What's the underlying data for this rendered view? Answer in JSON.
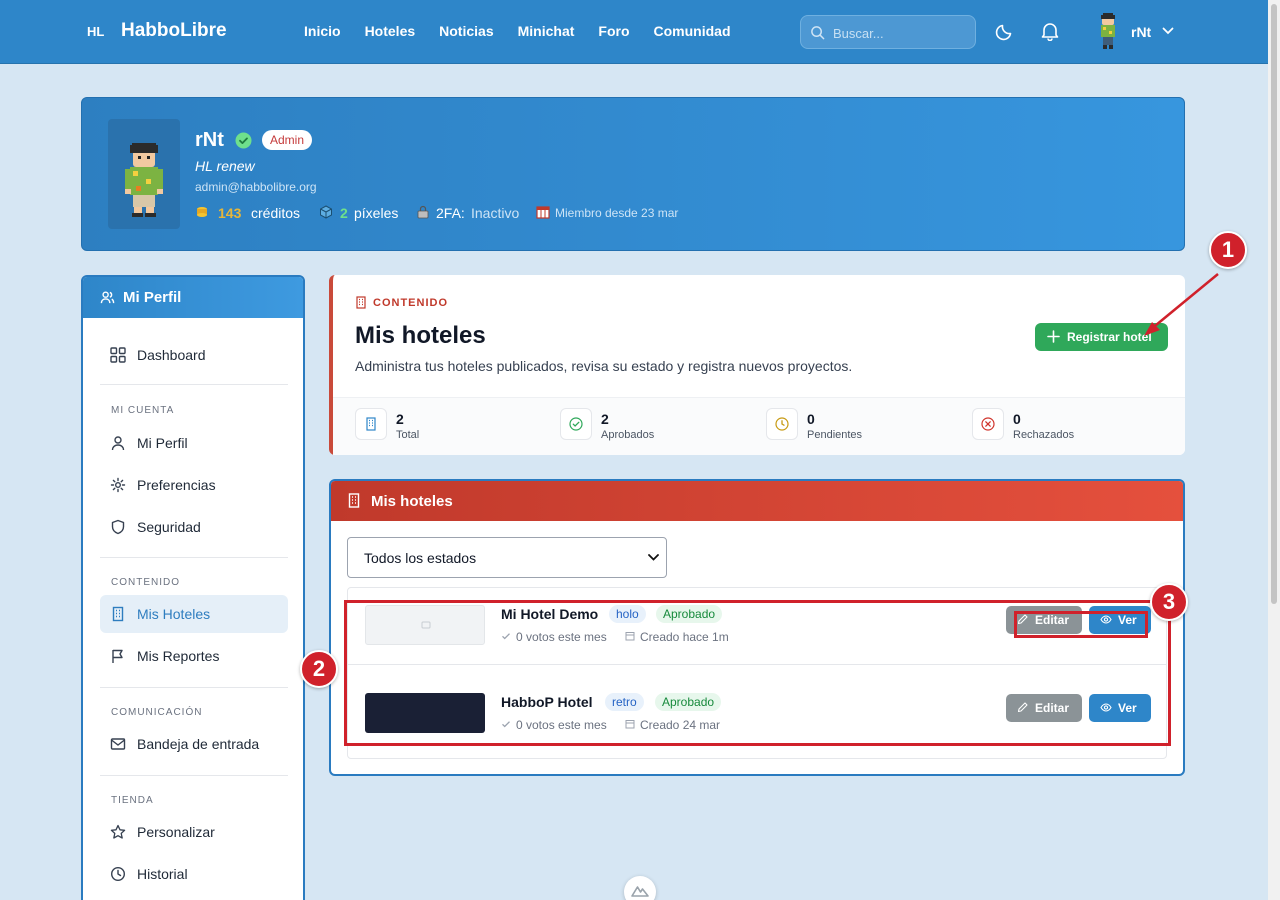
{
  "nav": {
    "brand_abbr": "HL",
    "brand_name": "HabboLibre",
    "links": [
      "Inicio",
      "Hoteles",
      "Noticias",
      "Minichat",
      "Foro",
      "Comunidad"
    ],
    "search_placeholder": "Buscar...",
    "username": "rNt"
  },
  "profile": {
    "name": "rNt",
    "badge": "Admin",
    "motto": "HL renew",
    "email": "admin@habbolibre.org",
    "credits_value": "143",
    "credits_label": "créditos",
    "pixels_value": "2",
    "pixels_label": "píxeles",
    "twofa_label": "2FA:",
    "twofa_value": "Inactivo",
    "member_since": "Miembro desde 23 mar"
  },
  "sidebar": {
    "title": "Mi Perfil",
    "dashboard": "Dashboard",
    "sections": [
      {
        "title": "MI CUENTA",
        "items": [
          "Mi Perfil",
          "Preferencias",
          "Seguridad"
        ]
      },
      {
        "title": "CONTENIDO",
        "items": [
          "Mis Hoteles",
          "Mis Reportes"
        ]
      },
      {
        "title": "COMUNICACIÓN",
        "items": [
          "Bandeja de entrada"
        ]
      },
      {
        "title": "TIENDA",
        "items": [
          "Personalizar",
          "Historial"
        ]
      }
    ],
    "active_item": "Mis Hoteles"
  },
  "summary": {
    "category": "CONTENIDO",
    "title": "Mis hoteles",
    "description": "Administra tus hoteles publicados, revisa su estado y registra nuevos proyectos.",
    "register_button": "Registrar hotel",
    "stats": [
      {
        "value": "2",
        "label": "Total"
      },
      {
        "value": "2",
        "label": "Aprobados"
      },
      {
        "value": "0",
        "label": "Pendientes"
      },
      {
        "value": "0",
        "label": "Rechazados"
      }
    ]
  },
  "hotels_panel": {
    "title": "Mis hoteles",
    "filter_value": "Todos los estados",
    "edit_label": "Editar",
    "view_label": "Ver",
    "rows": [
      {
        "name": "Mi Hotel Demo",
        "type": "holo",
        "status": "Aprobado",
        "votes": "0 votos este mes",
        "created": "Creado hace 1m"
      },
      {
        "name": "HabboP Hotel",
        "type": "retro",
        "status": "Aprobado",
        "votes": "0 votos este mes",
        "created": "Creado 24 mar"
      }
    ]
  },
  "annotations": [
    "1",
    "2",
    "3"
  ],
  "colors": {
    "primary": "#2e86c9",
    "accent_red": "#c0392b",
    "success": "#2fa85a",
    "annotation": "#d0212b"
  }
}
